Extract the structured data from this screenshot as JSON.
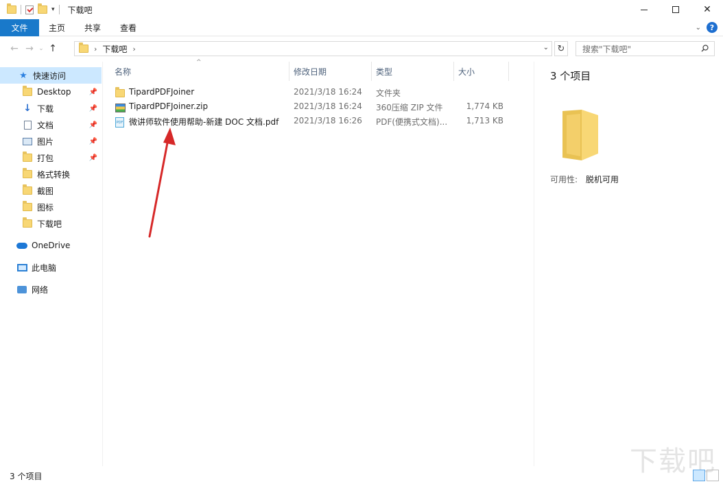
{
  "window": {
    "title": "下载吧",
    "minimize_label": "",
    "close_label": "✕"
  },
  "ribbon": {
    "tabs": [
      {
        "label": "文件"
      },
      {
        "label": "主页"
      },
      {
        "label": "共享"
      },
      {
        "label": "查看"
      }
    ]
  },
  "address": {
    "crumb": "下载吧",
    "search_placeholder": "搜索\"下载吧\""
  },
  "sidebar": {
    "quick_access": "快速访问",
    "items": [
      {
        "label": "Desktop",
        "icon": "folder-icon",
        "pinned": true
      },
      {
        "label": "下载",
        "icon": "download-arrow-icon",
        "pinned": true
      },
      {
        "label": "文档",
        "icon": "document-icon",
        "pinned": true
      },
      {
        "label": "图片",
        "icon": "picture-icon",
        "pinned": true
      },
      {
        "label": "打包",
        "icon": "folder-icon",
        "pinned": true
      },
      {
        "label": "格式转换",
        "icon": "folder-icon",
        "pinned": false
      },
      {
        "label": "截图",
        "icon": "folder-icon",
        "pinned": false
      },
      {
        "label": "图标",
        "icon": "folder-icon",
        "pinned": false
      },
      {
        "label": "下载吧",
        "icon": "folder-icon",
        "pinned": false
      }
    ],
    "onedrive": "OneDrive",
    "this_pc": "此电脑",
    "network": "网络"
  },
  "columns": {
    "name": "名称",
    "date": "修改日期",
    "type": "类型",
    "size": "大小"
  },
  "files": [
    {
      "name": "TipardPDFJoiner",
      "date": "2021/3/18 16:24",
      "type": "文件夹",
      "size": "",
      "icon": "folder-icon"
    },
    {
      "name": "TipardPDFJoiner.zip",
      "date": "2021/3/18 16:24",
      "type": "360压缩 ZIP 文件",
      "size": "1,774 KB",
      "icon": "zip-archive-icon"
    },
    {
      "name": "微讲师软件使用帮助-新建 DOC 文档.pdf",
      "date": "2021/3/18 16:26",
      "type": "PDF(便携式文档)...",
      "size": "1,713 KB",
      "icon": "pdf-file-icon"
    }
  ],
  "details": {
    "count": "3 个项目",
    "availability_key": "可用性:",
    "availability_value": "脱机可用"
  },
  "status": {
    "count": "3 个项目"
  },
  "watermark": "下载吧"
}
